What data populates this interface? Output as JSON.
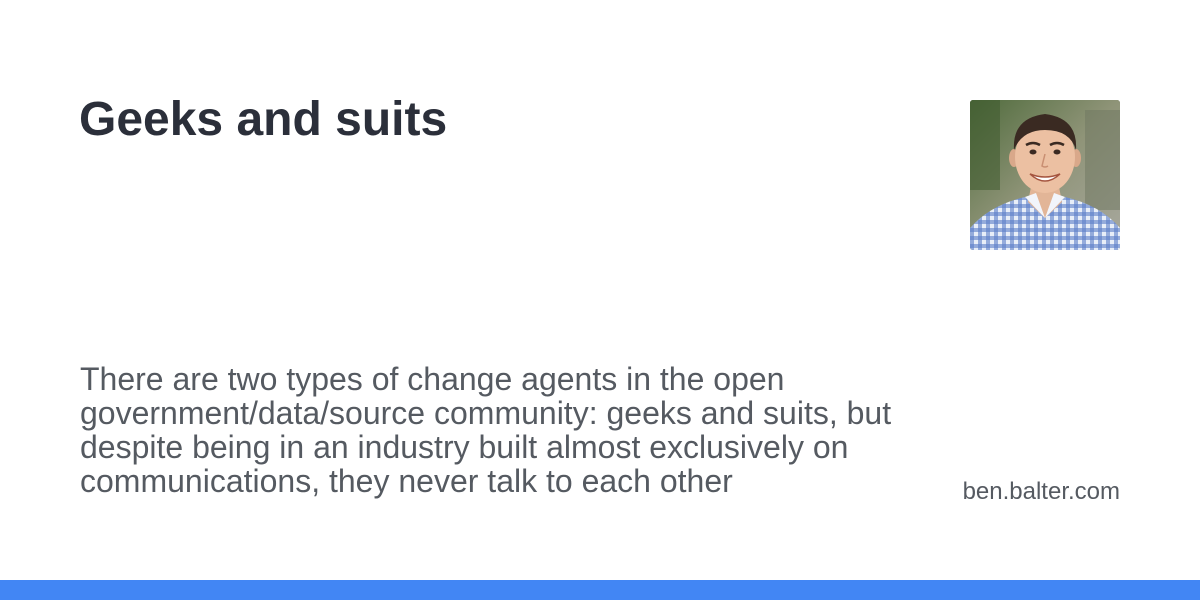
{
  "card": {
    "title": "Geeks and suits",
    "description": "There are two types of change agents in the open government/data/source community: geeks and suits, but despite being in an industry built almost exclusively on communications, they never talk to each other",
    "site": "ben.balter.com"
  },
  "avatar": {
    "icon": "author-avatar"
  },
  "colors": {
    "accent_bar": "#4286f4",
    "title_text": "#2b2f3a",
    "body_text": "#555a61",
    "background": "#ffffff"
  }
}
